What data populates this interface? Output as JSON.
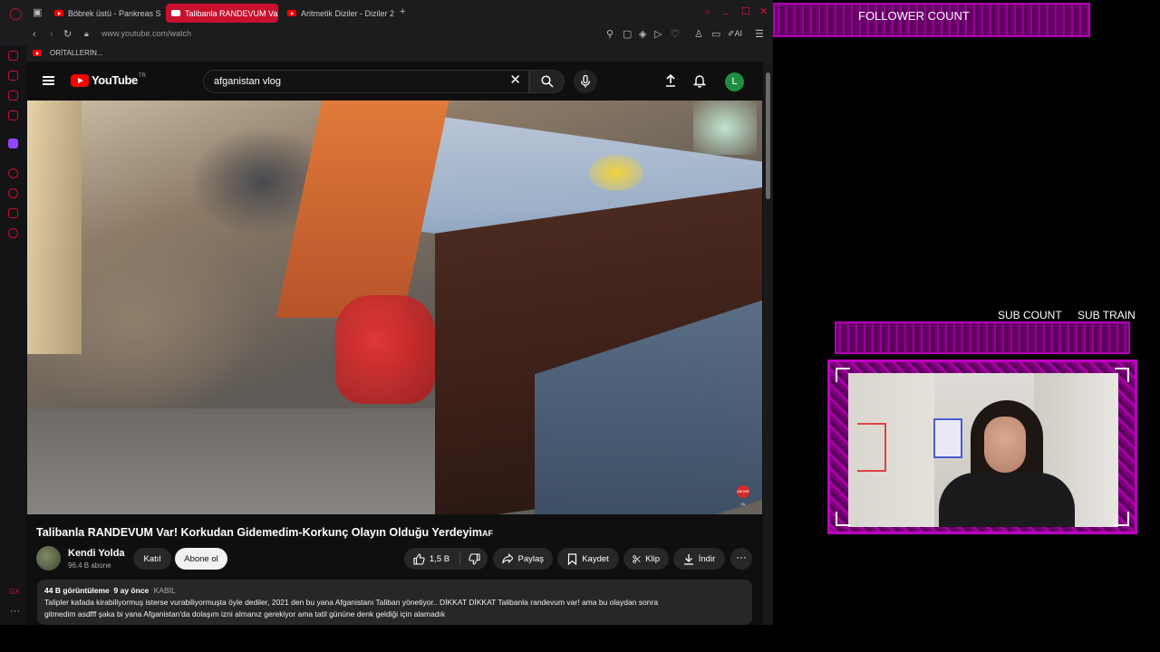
{
  "browser": {
    "tabs": [
      {
        "label": "Böbrek üstü - Pankreas Sc",
        "active": false
      },
      {
        "label": "Talibanla RANDEVUM Var!",
        "active": true
      },
      {
        "label": "Aritmetik Diziler - Diziler 2",
        "active": false
      }
    ],
    "url": "www.youtube.com/watch",
    "bookmark": "ORİTALLERİN...",
    "ai_label": "AI"
  },
  "youtube": {
    "logo_text": "YouTube",
    "country_code": "TR",
    "search_value": "afganistan vlog",
    "avatar_letter": "L",
    "video_title": "Talibanla RANDEVUM Var! Korkudan Gidemedim-Korkunç Olayın Olduğu Yerdeyim",
    "title_flag": "AF",
    "channel_name": "Kendi Yolda",
    "channel_subs": "96,4 B abone",
    "join_label": "Katıl",
    "subscribe_label": "Abone ol",
    "likes": "1,5 B",
    "share_label": "Paylaş",
    "save_label": "Kaydet",
    "clip_label": "Klip",
    "download_label": "İndir",
    "views": "44 B görüntüleme",
    "age": "9 ay önce",
    "location": "KABİL",
    "description_line1": "Talipler kafada kirabiliyormuş isterse vurabiliyormuşta öyle dediler, 2021 den bu yana Afganistanı Taliban yönetiyor.. DİKKAT DİKKAT Talibanla randevum var! ama bu olaydan sonra",
    "description_line2": "gitmedim asdfff şaka bi yana Afganistan'da dolaşım izni almanız gerekiyor ama tatil gününe denk geldiği için alamadık",
    "watermark": "ABONE OL"
  },
  "overlay": {
    "follower_label": "FOLLOWER COUNT",
    "sub_count_label": "SUB COUNT",
    "sub_train_label": "SUB TRAIN",
    "accent_color": "#b400b4"
  },
  "icons": [
    "opera-icon",
    "back-icon",
    "forward-icon",
    "reload-icon",
    "lock-icon",
    "menu-icon",
    "search-icon",
    "close-icon",
    "mic-icon",
    "upload-icon",
    "bell-icon",
    "like-icon",
    "dislike-icon",
    "share-icon",
    "bookmark-icon",
    "scissors-icon",
    "download-icon",
    "more-icon"
  ]
}
